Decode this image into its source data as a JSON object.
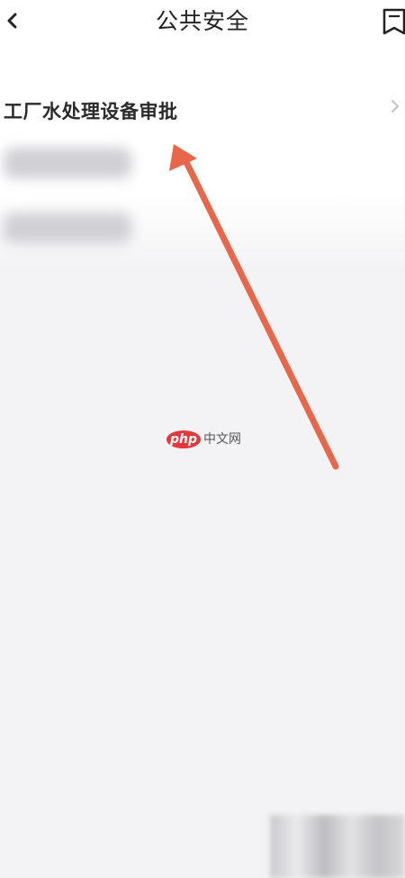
{
  "header": {
    "title": "公共安全",
    "back_icon": "chevron-left-icon",
    "bookmark_icon": "bookmark-icon"
  },
  "list": {
    "items": [
      {
        "label": "工厂水处理设备审批",
        "icon": "chevron-right-icon"
      }
    ]
  },
  "watermark": {
    "logo": "php",
    "text": "中文网"
  },
  "colors": {
    "background": "#f3f3f5",
    "panel": "#ffffff",
    "arrow": "#e8674a",
    "watermark_logo": "#e4393c"
  }
}
